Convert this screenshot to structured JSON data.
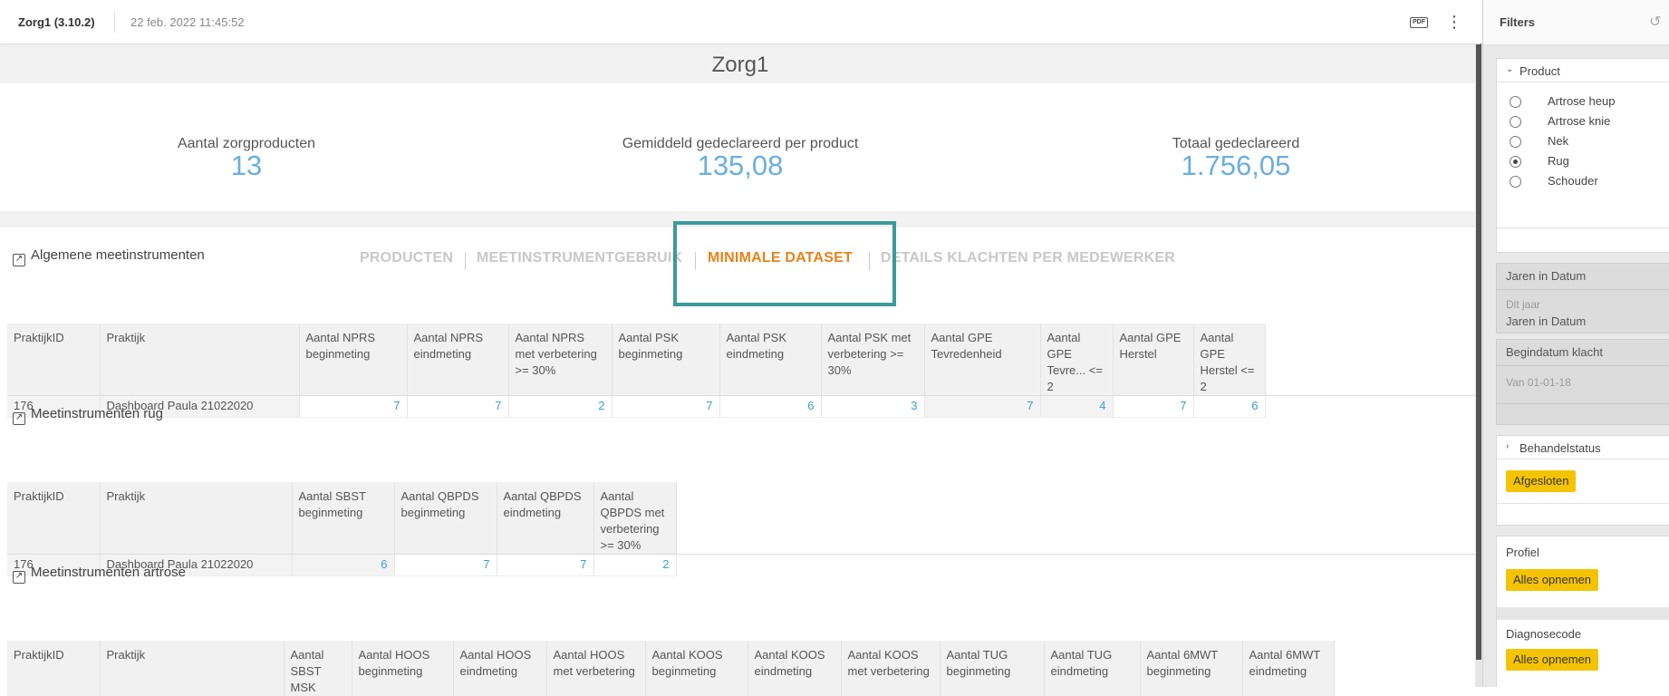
{
  "header": {
    "app_title": "Zorg1 (3.10.2)",
    "date": "22 feb. 2022 11:45:52",
    "pdf_label": "PDF",
    "more_icon": "more-vertical-icon"
  },
  "page_title": "Zorg1",
  "kpis": [
    {
      "label": "Aantal zorgproducten",
      "value": "13"
    },
    {
      "label": "Gemiddeld gedeclareerd per product",
      "value": "135,08"
    },
    {
      "label": "Totaal gedeclareerd",
      "value": "1.756,05"
    }
  ],
  "kpi_color": "#6aaee2",
  "tabs": [
    {
      "label": "PRODUCTEN",
      "active": false
    },
    {
      "label": "MEETINSTRUMENTGEBRUIK",
      "active": false
    },
    {
      "label": "MINIMALE DATASET",
      "active": true
    },
    {
      "label": "DETAILS KLACHTEN PER MEDEWERKER",
      "active": false
    }
  ],
  "active_tab_color": "#e8821a",
  "highlight_color": "#3a9b9b",
  "sections": {
    "algemeen": {
      "title": "Algemene meetinstrumenten",
      "columns": [
        "PraktijkID",
        "Praktijk",
        "Aantal NPRS beginmeting",
        "Aantal NPRS eindmeting",
        "Aantal NPRS met verbetering >= 30%",
        "Aantal PSK beginmeting",
        "Aantal PSK eindmeting",
        "Aantal PSK met verbetering >= 30%",
        "Aantal GPE Tevredenheid",
        "Aantal GPE Tevre... <= 2",
        "Aantal GPE Herstel",
        "Aantal GPE Herstel <= 2"
      ],
      "rows": [
        [
          "176",
          "Dashboard Paula 21022020",
          "7",
          "7",
          "2",
          "7",
          "6",
          "3",
          "7",
          "4",
          "7",
          "6"
        ]
      ]
    },
    "rug": {
      "title": "Meetinstrumenten rug",
      "columns": [
        "PraktijkID",
        "Praktijk",
        "Aantal SBST beginmeting",
        "Aantal QBPDS beginmeting",
        "Aantal QBPDS eindmeting",
        "Aantal QBPDS met verbetering >= 30%"
      ],
      "rows": [
        [
          "176",
          "Dashboard Paula 21022020",
          "6",
          "7",
          "7",
          "2"
        ]
      ]
    },
    "artrose": {
      "title": "Meetinstrumenten artrose",
      "columns": [
        "PraktijkID",
        "Praktijk",
        "Aantal SBST MSK",
        "Aantal HOOS beginmeting",
        "Aantal HOOS eindmeting",
        "Aantal HOOS met verbetering",
        "Aantal KOOS beginmeting",
        "Aantal KOOS eindmeting",
        "Aantal KOOS met verbetering",
        "Aantal TUG beginmeting",
        "Aantal TUG eindmeting",
        "Aantal 6MWT beginmeting",
        "Aantal 6MWT eindmeting"
      ]
    }
  },
  "filters": {
    "title": "Filters",
    "reset_icon": "reset-icon",
    "product": {
      "label": "Product",
      "options": [
        {
          "label": "Artrose heup",
          "selected": false
        },
        {
          "label": "Artrose knie",
          "selected": false
        },
        {
          "label": "Nek",
          "selected": false
        },
        {
          "label": "Rug",
          "selected": true
        },
        {
          "label": "Schouder",
          "selected": false
        }
      ]
    },
    "jaren": {
      "label": "Jaren in Datum",
      "value_hint": "Dit jaar",
      "value": "Jaren in Datum"
    },
    "begindatum": {
      "label": "Begindatum klacht",
      "value_hint": "Van 01-01-18"
    },
    "behandelstatus": {
      "label": "Behandelstatus",
      "chip": "Afgesloten"
    },
    "profiel": {
      "label": "Profiel",
      "chip": "Alles opnemen"
    },
    "diagnosecode": {
      "label": "Diagnosecode",
      "chip": "Alles opnemen"
    },
    "chip_color": "#f5c400"
  }
}
